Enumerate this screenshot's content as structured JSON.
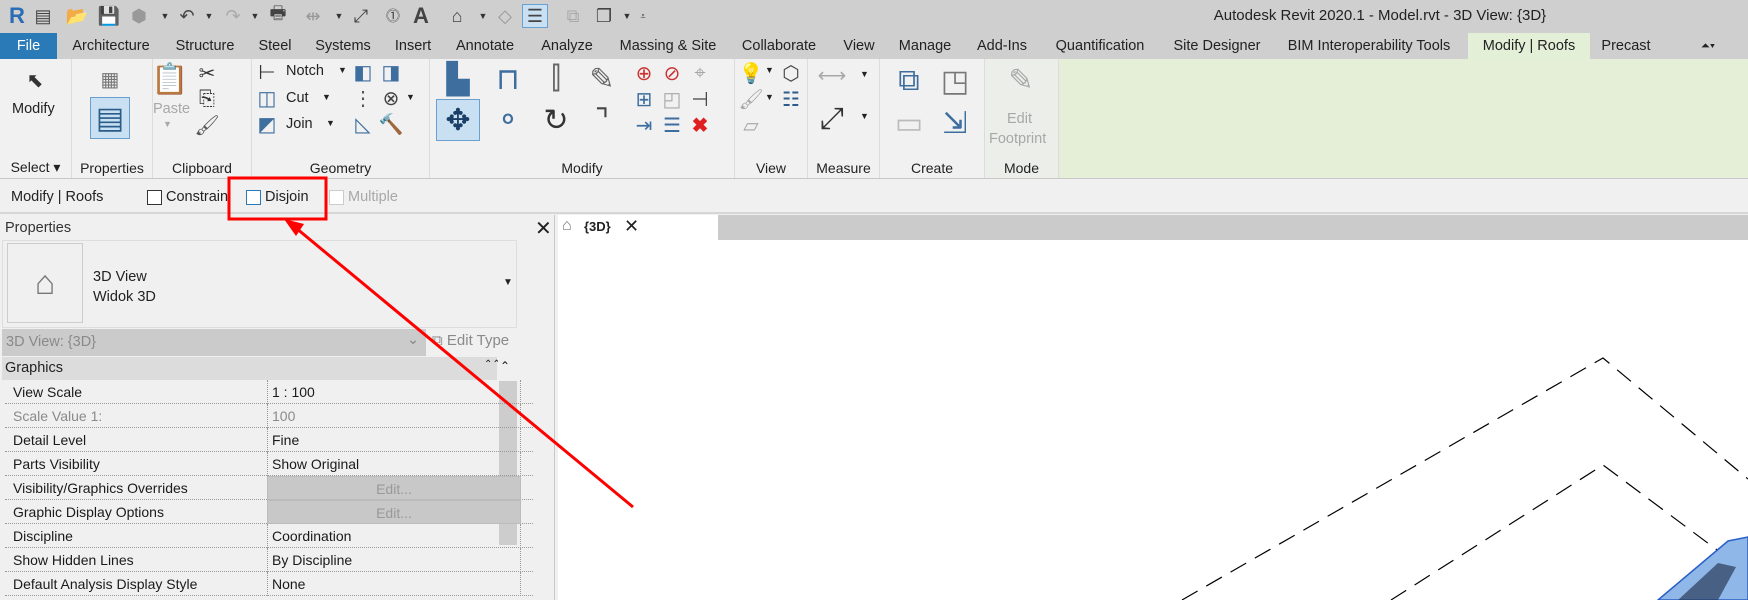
{
  "window": {
    "title": "Autodesk Revit 2020.1 - Model.rvt - 3D View: {3D}"
  },
  "quick_access": [
    "revit-logo",
    "recent-files",
    "open",
    "save",
    "sync",
    "undo",
    "redo",
    "print",
    "measure",
    "aligned-dimension",
    "tag",
    "text",
    "default-3d-view",
    "section",
    "thin-lines",
    "close-inactive",
    "switch-windows",
    "customize"
  ],
  "ribbon_tabs": [
    {
      "label": "File"
    },
    {
      "label": "Architecture"
    },
    {
      "label": "Structure"
    },
    {
      "label": "Steel"
    },
    {
      "label": "Systems"
    },
    {
      "label": "Insert"
    },
    {
      "label": "Annotate"
    },
    {
      "label": "Analyze"
    },
    {
      "label": "Massing & Site"
    },
    {
      "label": "Collaborate"
    },
    {
      "label": "View"
    },
    {
      "label": "Manage"
    },
    {
      "label": "Add-Ins"
    },
    {
      "label": "Quantification"
    },
    {
      "label": "Site Designer"
    },
    {
      "label": "BIM Interoperability Tools"
    },
    {
      "label": "Modify | Roofs"
    },
    {
      "label": "Precast"
    }
  ],
  "ribbon": {
    "modify_label": "Modify",
    "paste_label": "Paste",
    "notch_label": "Notch",
    "cut_label": "Cut",
    "join_label": "Join",
    "edit_label": "Edit",
    "footprint_label": "Footprint",
    "panels": {
      "select": "Select",
      "properties": "Properties",
      "clipboard": "Clipboard",
      "geometry": "Geometry",
      "modify": "Modify",
      "view": "View",
      "measure": "Measure",
      "create": "Create",
      "mode": "Mode"
    }
  },
  "options_bar": {
    "context": "Modify | Roofs",
    "constrain": "Constrain",
    "disjoin": "Disjoin",
    "multiple": "Multiple"
  },
  "properties": {
    "title": "Properties",
    "type_name": "3D View",
    "type_sub": "Widok 3D",
    "instance_selector": "3D View: {3D}",
    "edit_type": "Edit Type",
    "group": "Graphics",
    "rows": [
      {
        "label": "View Scale",
        "value": "1 : 100"
      },
      {
        "label": "Scale Value    1:",
        "value": "100"
      },
      {
        "label": "Detail Level",
        "value": "Fine"
      },
      {
        "label": "Parts Visibility",
        "value": "Show Original"
      },
      {
        "label": "Visibility/Graphics Overrides",
        "value": "Edit..."
      },
      {
        "label": "Graphic Display Options",
        "value": "Edit..."
      },
      {
        "label": "Discipline",
        "value": "Coordination"
      },
      {
        "label": "Show Hidden Lines",
        "value": "By Discipline"
      },
      {
        "label": "Default Analysis Display Style",
        "value": "None"
      }
    ]
  },
  "view": {
    "tab_label": "{3D}"
  },
  "colors": {
    "file_tab": "#2a7ab8",
    "active_tab": "#e4efd8",
    "annotation": "#ff0000"
  }
}
